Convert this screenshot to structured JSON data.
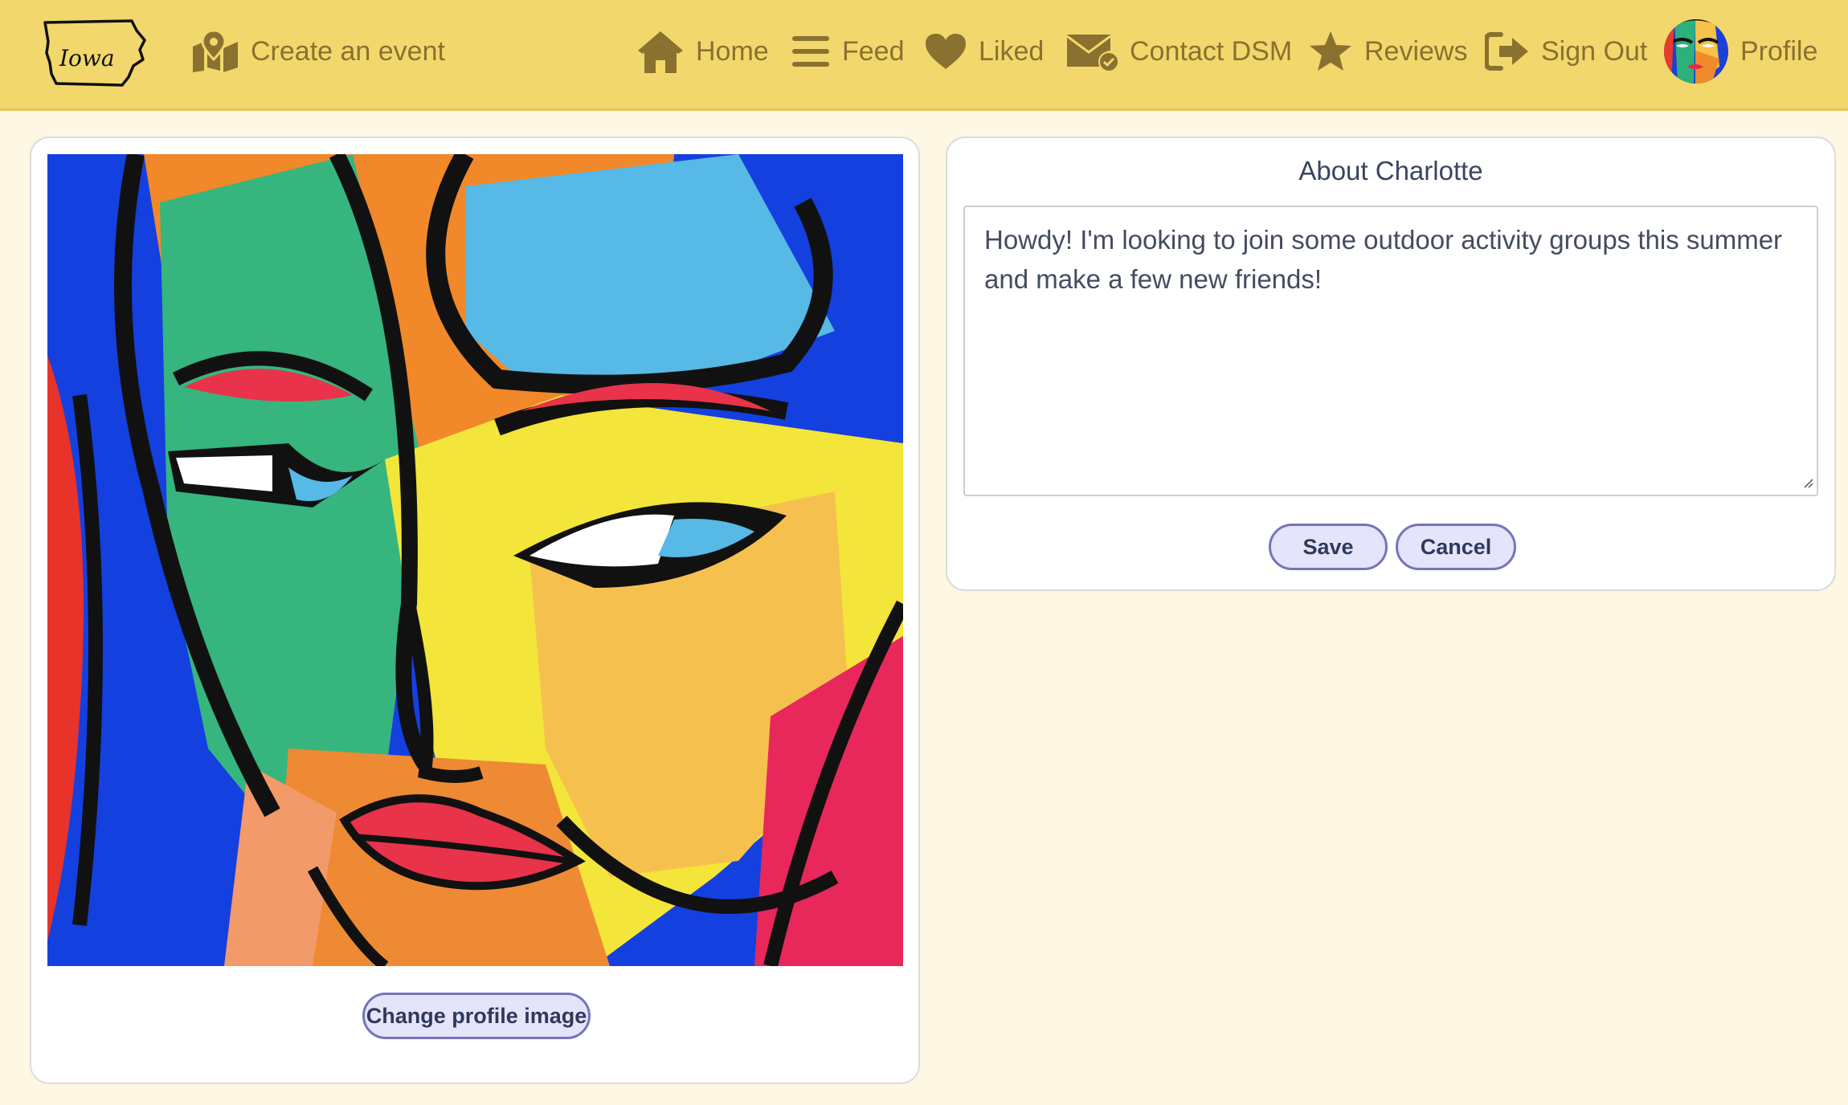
{
  "navbar": {
    "logo_text": "Iowa",
    "create_event": "Create an event",
    "home": "Home",
    "feed": "Feed",
    "liked": "Liked",
    "contact": "Contact DSM",
    "reviews": "Reviews",
    "sign_out": "Sign Out",
    "profile": "Profile"
  },
  "profile_card": {
    "change_image_label": "Change profile image"
  },
  "about_card": {
    "title": "About Charlotte",
    "bio_text": "Howdy! I'm looking to join some outdoor activity groups this summer and make a few new friends!",
    "save_label": "Save",
    "cancel_label": "Cancel"
  },
  "colors": {
    "navbar_bg": "#f2d86c",
    "nav_text": "#8a7130",
    "page_bg": "#fdf7e3",
    "button_bg": "#e4e4fb",
    "button_border": "#7674ba"
  },
  "icons": [
    "iowa-logo",
    "map-pin-icon",
    "home-icon",
    "bars-icon",
    "heart-icon",
    "envelope-check-icon",
    "star-icon",
    "sign-out-icon",
    "avatar"
  ]
}
